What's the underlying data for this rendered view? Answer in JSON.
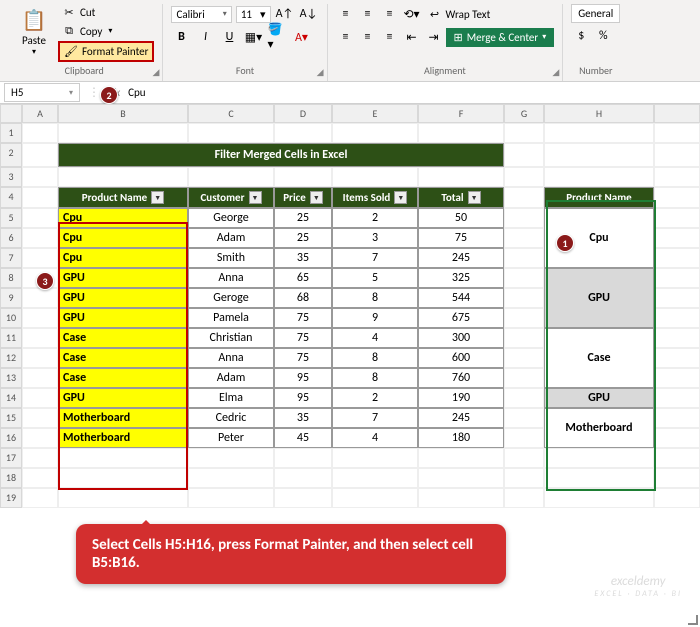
{
  "ribbon": {
    "clipboard": {
      "paste": "Paste",
      "cut": "Cut",
      "copy": "Copy",
      "format_painter": "Format Painter",
      "label": "Clipboard"
    },
    "font": {
      "name": "Calibri",
      "size": "11",
      "bold": "B",
      "italic": "I",
      "underline": "U",
      "label": "Font"
    },
    "alignment": {
      "wrap": "Wrap Text",
      "merge": "Merge & Center",
      "label": "Alignment"
    },
    "number": {
      "format": "General",
      "currency": "$",
      "percent": "%",
      "label": "Number"
    }
  },
  "formula_bar": {
    "cell_ref": "H5",
    "fx": "fx",
    "value": "Cpu"
  },
  "badges": {
    "b1": "1",
    "b2": "2",
    "b3": "3"
  },
  "grid": {
    "cols": [
      "A",
      "B",
      "C",
      "D",
      "E",
      "F",
      "G",
      "H"
    ],
    "title": "Filter Merged Cells in Excel",
    "headers": [
      "Product Name",
      "Customer",
      "Price",
      "Items Sold",
      "Total"
    ],
    "header_h": "Product Name",
    "rows": [
      {
        "r": "5",
        "p": "Cpu",
        "c": "George",
        "pr": "25",
        "i": "2",
        "t": "50"
      },
      {
        "r": "6",
        "p": "Cpu",
        "c": "Adam",
        "pr": "25",
        "i": "3",
        "t": "75"
      },
      {
        "r": "7",
        "p": "Cpu",
        "c": "Smith",
        "pr": "35",
        "i": "7",
        "t": "245"
      },
      {
        "r": "8",
        "p": "GPU",
        "c": "Anna",
        "pr": "65",
        "i": "5",
        "t": "325"
      },
      {
        "r": "9",
        "p": "GPU",
        "c": "Geroge",
        "pr": "68",
        "i": "8",
        "t": "544"
      },
      {
        "r": "10",
        "p": "GPU",
        "c": "Pamela",
        "pr": "75",
        "i": "9",
        "t": "675"
      },
      {
        "r": "11",
        "p": "Case",
        "c": "Christian",
        "pr": "75",
        "i": "4",
        "t": "300"
      },
      {
        "r": "12",
        "p": "Case",
        "c": "Anna",
        "pr": "75",
        "i": "8",
        "t": "600"
      },
      {
        "r": "13",
        "p": "Case",
        "c": "Adam",
        "pr": "95",
        "i": "8",
        "t": "760"
      },
      {
        "r": "14",
        "p": "GPU",
        "c": "Elma",
        "pr": "95",
        "i": "2",
        "t": "190"
      },
      {
        "r": "15",
        "p": "Motherboard",
        "c": "Cedric",
        "pr": "35",
        "i": "7",
        "t": "245"
      },
      {
        "r": "16",
        "p": "Motherboard",
        "c": "Peter",
        "pr": "45",
        "i": "4",
        "t": "180"
      }
    ],
    "merged_h": [
      "Cpu",
      "GPU",
      "Case",
      "Motherboard"
    ],
    "extra_rows": [
      "17",
      "18",
      "19"
    ]
  },
  "callout": "Select Cells H5:H16, press Format Painter, and then select cell B5:B16.",
  "watermark": {
    "main": "exceldemy",
    "sub": "EXCEL · DATA · BI"
  }
}
